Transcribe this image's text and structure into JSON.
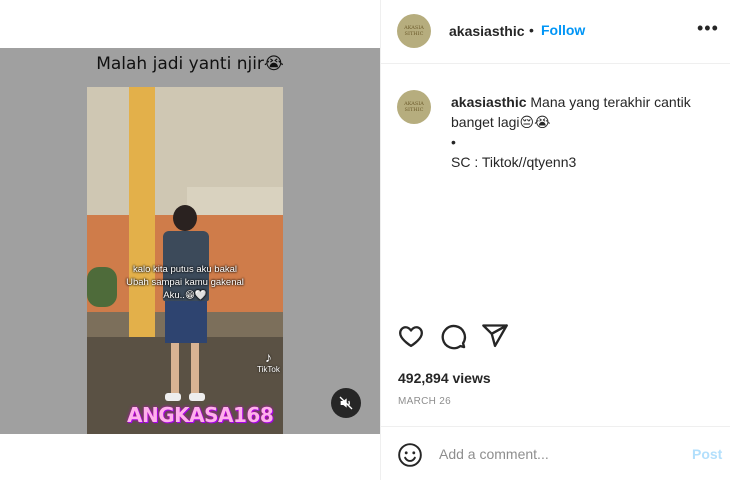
{
  "video": {
    "caption": "Malah jadi yanti njir😭",
    "overlay_lines": [
      "kalo kita putus aku bakal",
      "Ubah sampai kamu gakenal",
      "Aku..😁🤍"
    ],
    "tiktok_label": "TikTok",
    "watermark": "ANGKASA168"
  },
  "header": {
    "avatar_text": "AKASIA SITHIC",
    "username": "akasiasthic",
    "dot": "•",
    "follow_label": "Follow",
    "more_icon": "more-horizontal-icon"
  },
  "caption": {
    "avatar_text": "AKASIA SITHIC",
    "username": "akasiasthic",
    "text": "Mana yang terakhir cantik banget lagi😔😭",
    "bullet": "•",
    "source": "SC : Tiktok//qtyenn3"
  },
  "actions": {
    "icons": [
      "heart-icon",
      "comment-icon",
      "share-icon"
    ]
  },
  "stats": {
    "views": "492,894 views",
    "date": "MARCH 26"
  },
  "comment": {
    "placeholder": "Add a comment...",
    "post_label": "Post"
  },
  "colors": {
    "accent": "#0095f6",
    "post_disabled": "#b2dffc",
    "media_background": "#a0a0a0"
  }
}
